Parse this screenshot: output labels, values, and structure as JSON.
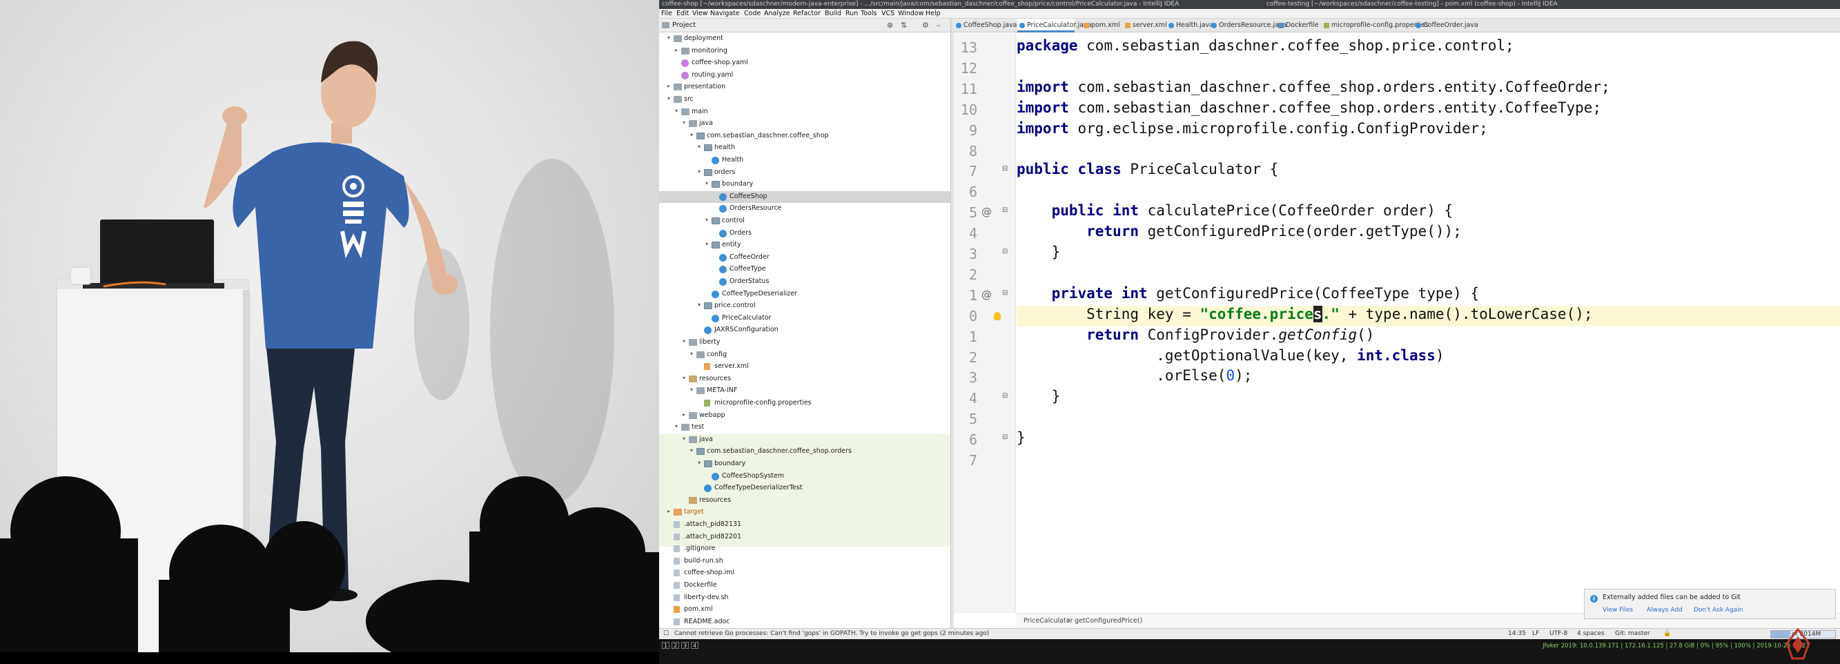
{
  "ide": {
    "titlebar": {
      "left": "coffee-shop [~/workspaces/sdaschner/modern-java-enterprise] - .../src/main/java/com/sebastian_daschner/coffee_shop/price/control/PriceCalculator.java - IntelliJ IDEA",
      "right": "coffee-testing [~/workspaces/sdaschner/coffee-testing] - pom.xml (coffee-shop) - IntelliJ IDEA"
    },
    "menu": [
      "File",
      "Edit",
      "View",
      "Navigate",
      "Code",
      "Analyze",
      "Refactor",
      "Build",
      "Run",
      "Tools",
      "VCS",
      "Window",
      "Help"
    ],
    "project_panel": {
      "title": "Project",
      "tree": [
        {
          "label": "deployment",
          "depth": 1,
          "icon": "folder",
          "arrow": "▾"
        },
        {
          "label": "monitoring",
          "depth": 2,
          "icon": "folder",
          "arrow": "▸"
        },
        {
          "label": "coffee-shop.yaml",
          "depth": 2,
          "icon": "yaml",
          "arrow": ""
        },
        {
          "label": "routing.yaml",
          "depth": 2,
          "icon": "yaml",
          "arrow": ""
        },
        {
          "label": "presentation",
          "depth": 1,
          "icon": "folder",
          "arrow": "▸"
        },
        {
          "label": "src",
          "depth": 1,
          "icon": "folder",
          "arrow": "▾"
        },
        {
          "label": "main",
          "depth": 2,
          "icon": "folder",
          "arrow": "▾"
        },
        {
          "label": "java",
          "depth": 3,
          "icon": "folder",
          "arrow": "▾"
        },
        {
          "label": "com.sebastian_daschner.coffee_shop",
          "depth": 4,
          "icon": "pkg",
          "arrow": "▾"
        },
        {
          "label": "health",
          "depth": 5,
          "icon": "pkg",
          "arrow": "▾"
        },
        {
          "label": "Health",
          "depth": 6,
          "icon": "cls",
          "arrow": ""
        },
        {
          "label": "orders",
          "depth": 5,
          "icon": "pkg",
          "arrow": "▾"
        },
        {
          "label": "boundary",
          "depth": 6,
          "icon": "pkg",
          "arrow": "▾"
        },
        {
          "label": "CoffeeShop",
          "depth": 7,
          "icon": "cls",
          "arrow": "",
          "selected": true
        },
        {
          "label": "OrdersResource",
          "depth": 7,
          "icon": "cls",
          "arrow": ""
        },
        {
          "label": "control",
          "depth": 6,
          "icon": "pkg",
          "arrow": "▾"
        },
        {
          "label": "Orders",
          "depth": 7,
          "icon": "cls",
          "arrow": ""
        },
        {
          "label": "entity",
          "depth": 6,
          "icon": "pkg",
          "arrow": "▾"
        },
        {
          "label": "CoffeeOrder",
          "depth": 7,
          "icon": "cls",
          "arrow": ""
        },
        {
          "label": "CoffeeType",
          "depth": 7,
          "icon": "cls",
          "arrow": ""
        },
        {
          "label": "OrderStatus",
          "depth": 7,
          "icon": "cls",
          "arrow": ""
        },
        {
          "label": "CoffeeTypeDeserializer",
          "depth": 6,
          "icon": "cls",
          "arrow": ""
        },
        {
          "label": "price.control",
          "depth": 5,
          "icon": "pkg",
          "arrow": "▾"
        },
        {
          "label": "PriceCalculator",
          "depth": 6,
          "icon": "cls",
          "arrow": ""
        },
        {
          "label": "JAXRSConfiguration",
          "depth": 5,
          "icon": "cls",
          "arrow": ""
        },
        {
          "label": "liberty",
          "depth": 3,
          "icon": "folder",
          "arrow": "▾"
        },
        {
          "label": "config",
          "depth": 4,
          "icon": "folder",
          "arrow": "▾"
        },
        {
          "label": "server.xml",
          "depth": 5,
          "icon": "xml",
          "arrow": ""
        },
        {
          "label": "resources",
          "depth": 3,
          "icon": "res",
          "arrow": "▾"
        },
        {
          "label": "META-INF",
          "depth": 4,
          "icon": "folder",
          "arrow": "▾"
        },
        {
          "label": "microprofile-config.properties",
          "depth": 5,
          "icon": "prop",
          "arrow": ""
        },
        {
          "label": "webapp",
          "depth": 3,
          "icon": "folder",
          "arrow": "▸"
        },
        {
          "label": "test",
          "depth": 2,
          "icon": "folder",
          "arrow": "▾"
        },
        {
          "label": "java",
          "depth": 3,
          "icon": "folder",
          "arrow": "▾"
        },
        {
          "label": "com.sebastian_daschner.coffee_shop.orders",
          "depth": 4,
          "icon": "pkg",
          "arrow": "▾"
        },
        {
          "label": "boundary",
          "depth": 5,
          "icon": "pkg",
          "arrow": "▾"
        },
        {
          "label": "CoffeeShopSystem",
          "depth": 6,
          "icon": "cls",
          "arrow": ""
        },
        {
          "label": "CoffeeTypeDeserializerTest",
          "depth": 5,
          "icon": "cls",
          "arrow": ""
        },
        {
          "label": "resources",
          "depth": 3,
          "icon": "res",
          "arrow": ""
        },
        {
          "label": "target",
          "depth": 1,
          "icon": "tgt",
          "arrow": "▸",
          "color": "orange"
        },
        {
          "label": ".attach_pid82131",
          "depth": 1,
          "icon": "file",
          "arrow": ""
        },
        {
          "label": ".attach_pid82201",
          "depth": 1,
          "icon": "file",
          "arrow": ""
        },
        {
          "label": ".gitignore",
          "depth": 1,
          "icon": "file",
          "arrow": ""
        },
        {
          "label": "build-run.sh",
          "depth": 1,
          "icon": "file",
          "arrow": ""
        },
        {
          "label": "coffee-shop.iml",
          "depth": 1,
          "icon": "file",
          "arrow": ""
        },
        {
          "label": "Dockerfile",
          "depth": 1,
          "icon": "file",
          "arrow": ""
        },
        {
          "label": "liberty-dev.sh",
          "depth": 1,
          "icon": "file",
          "arrow": ""
        },
        {
          "label": "pom.xml",
          "depth": 1,
          "icon": "xml",
          "arrow": ""
        },
        {
          "label": "README.adoc",
          "depth": 1,
          "icon": "file",
          "arrow": ""
        }
      ]
    },
    "tabs": [
      {
        "label": "CoffeeShop.java",
        "kind": "cls"
      },
      {
        "label": "PriceCalculator.java",
        "kind": "cls",
        "active": true
      },
      {
        "label": "pom.xml",
        "kind": "xml"
      },
      {
        "label": "server.xml",
        "kind": "xml"
      },
      {
        "label": "Health.java",
        "kind": "cls"
      },
      {
        "label": "OrdersResource.java",
        "kind": "cls"
      },
      {
        "label": "Dockerfile",
        "kind": "k"
      },
      {
        "label": "microprofile-config.properties",
        "kind": "p"
      },
      {
        "label": "CoffeeOrder.java",
        "kind": "cls"
      }
    ],
    "editor": {
      "line_numbers": [
        "13",
        "12",
        "11",
        "10",
        "9",
        "8",
        "7",
        "6",
        "5",
        "4",
        "3",
        "2",
        "1",
        "0",
        "1",
        "2",
        "3",
        "4",
        "5",
        "6",
        "7"
      ],
      "lines": [
        [
          [
            "kw",
            "package"
          ],
          [
            "",
            " com.sebastian_daschner.coffee_shop.price.control;"
          ]
        ],
        [],
        [
          [
            "kw",
            "import"
          ],
          [
            "",
            " com.sebastian_daschner.coffee_shop.orders.entity.CoffeeOrder;"
          ]
        ],
        [
          [
            "kw",
            "import"
          ],
          [
            "",
            " com.sebastian_daschner.coffee_shop.orders.entity.CoffeeType;"
          ]
        ],
        [
          [
            "kw",
            "import"
          ],
          [
            "",
            " org.eclipse.microprofile.config.ConfigProvider;"
          ]
        ],
        [],
        [
          [
            "kw",
            "public class"
          ],
          [
            "",
            " PriceCalculator {"
          ]
        ],
        [],
        [
          [
            "",
            "    "
          ],
          [
            "kw",
            "public int"
          ],
          [
            "",
            " calculatePrice(CoffeeOrder order) {"
          ]
        ],
        [
          [
            "",
            "        "
          ],
          [
            "kw",
            "return"
          ],
          [
            "",
            " getConfiguredPrice(order.getType());"
          ]
        ],
        [
          [
            "",
            "    }"
          ]
        ],
        [],
        [
          [
            "",
            "    "
          ],
          [
            "kw",
            "private int"
          ],
          [
            "",
            " getConfiguredPrice(CoffeeType type) {"
          ]
        ],
        [
          [
            "",
            "        String key = "
          ],
          [
            "str",
            "\"coffee.price"
          ],
          [
            "caret",
            "s"
          ],
          [
            "str",
            ".\""
          ],
          [
            "",
            " + type.name().toLowerCase();"
          ]
        ],
        [
          [
            "",
            "        "
          ],
          [
            "kw",
            "return"
          ],
          [
            "",
            " ConfigProvider."
          ],
          [
            "it",
            "getConfig"
          ],
          [
            "",
            "()"
          ]
        ],
        [
          [
            "",
            "                .getOptionalValue(key, "
          ],
          [
            "kw",
            "int.class"
          ],
          [
            "",
            ")"
          ]
        ],
        [
          [
            "",
            "                .orElse("
          ],
          [
            "num",
            "0"
          ],
          [
            "",
            ");"
          ]
        ],
        [
          [
            "",
            "    }"
          ]
        ],
        [],
        [
          [
            "",
            "}"
          ]
        ],
        []
      ],
      "current_line_index": 13
    },
    "breadcrumbs": [
      "PriceCalculator",
      "getConfiguredPrice()"
    ],
    "notification": {
      "title": "Externally added files can be added to Git",
      "actions": [
        "View Files",
        "Always Add",
        "Don't Ask Again"
      ]
    },
    "status": {
      "message": "Cannot retrieve Go processes: Can't find 'gops' in GOPATH. Try to invoke go get gops (2 minutes ago)",
      "position": "14:35",
      "line_sep": "LF",
      "encoding": "UTF-8",
      "indent": "4 spaces",
      "git": "Git: master",
      "memory": "of 2014M",
      "memory_fraction": 0.3
    },
    "taskbar": {
      "workspaces": [
        "1",
        "2",
        "3",
        "4"
      ],
      "right": "Jfoker 2019: 10.0.139.171 | 172.16.1.125 | 27.8 GiB | 0% | 95% | 100% | 2019-10-25 14:21"
    },
    "colors": {
      "accent": "#4a88c7",
      "keyword": "#000080",
      "string": "#067d17",
      "number": "#1750eb",
      "current_line": "#fcf8d6"
    }
  }
}
